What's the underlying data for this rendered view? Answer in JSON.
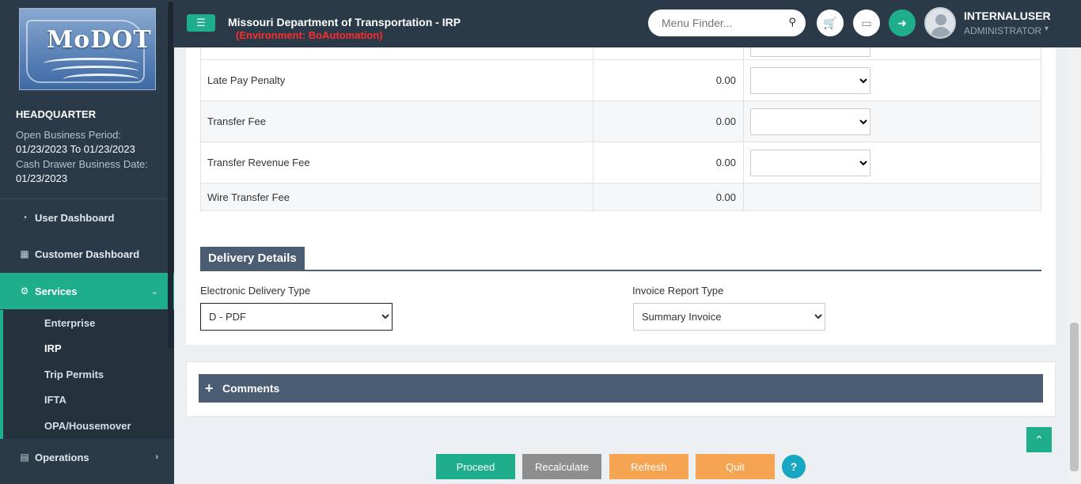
{
  "sidebar": {
    "logo_alt": "MoDOT",
    "office": "HEADQUARTER",
    "open_period_label": "Open Business Period:",
    "open_period_value": "01/23/2023 To 01/23/2023",
    "cash_drawer_label": "Cash Drawer Business Date:",
    "cash_drawer_value": "01/23/2023",
    "nav": {
      "user_dashboard": "User Dashboard",
      "customer_dashboard": "Customer Dashboard",
      "services": "Services",
      "operations": "Operations"
    },
    "services_sub": [
      "Enterprise",
      "IRP",
      "Trip Permits",
      "IFTA",
      "OPA/Housemover"
    ]
  },
  "header": {
    "title": "Missouri Department of Transportation - IRP",
    "environment": "(Environment: BoAutomation)",
    "search_placeholder": "Menu Finder...",
    "user_name": "INTERNALUSER",
    "user_role": "ADMINISTRATOR"
  },
  "fees": {
    "rows": [
      {
        "name": "Late Pay Penalty",
        "amount": "0.00",
        "has_select": true
      },
      {
        "name": "Transfer Fee",
        "amount": "0.00",
        "has_select": true
      },
      {
        "name": "Transfer Revenue Fee",
        "amount": "0.00",
        "has_select": true
      },
      {
        "name": "Wire Transfer Fee",
        "amount": "0.00",
        "has_select": false
      }
    ]
  },
  "delivery": {
    "section_title": "Delivery Details",
    "electronic_label": "Electronic Delivery Type",
    "electronic_value": "D - PDF",
    "invoice_label": "Invoice Report Type",
    "invoice_value": "Summary Invoice"
  },
  "comments": {
    "title": "Comments"
  },
  "actions": {
    "proceed": "Proceed",
    "recalculate": "Recalculate",
    "refresh": "Refresh",
    "quit": "Quit",
    "help": "?"
  },
  "colors": {
    "sidebar_bg": "#2a3a48",
    "accent_green": "#1fae8c",
    "env_red": "#ff2b2b",
    "section_header": "#4b5d73",
    "proceed": "#1fae8c",
    "recalculate": "#8e8e8e",
    "refresh_quit": "#f5a552",
    "help": "#17a7c3"
  }
}
